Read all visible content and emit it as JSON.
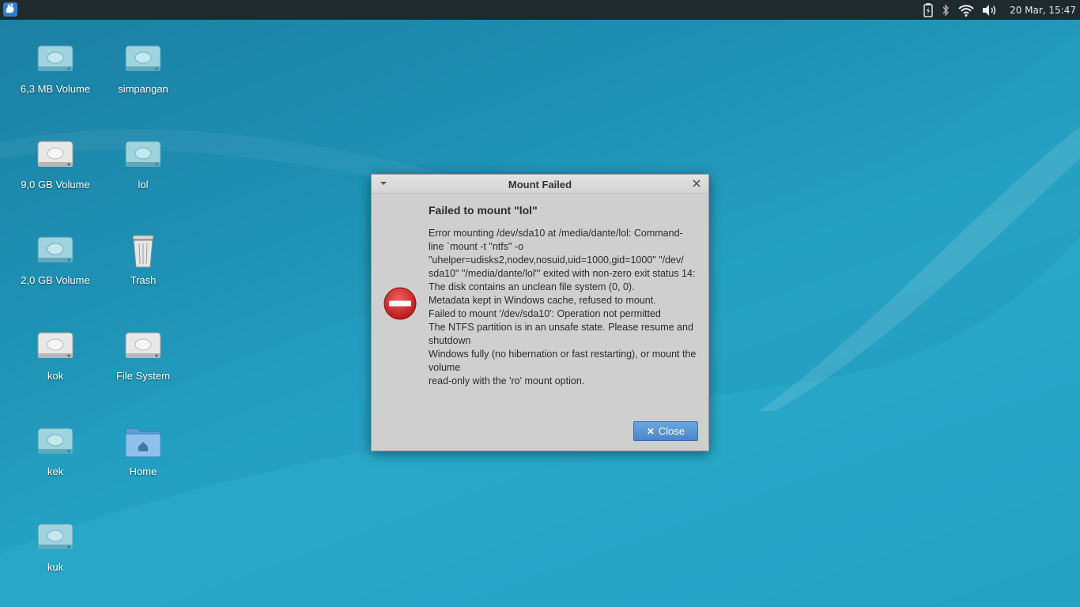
{
  "panel": {
    "clock": "20 Mar, 15:47"
  },
  "desktop": {
    "icons": [
      {
        "label": "6,3 MB Volume",
        "icon": "drive-icon"
      },
      {
        "label": "simpangan",
        "icon": "drive-icon"
      },
      {
        "label": "9,0 GB Volume",
        "icon": "drive-icon"
      },
      {
        "label": "lol",
        "icon": "drive-icon"
      },
      {
        "label": "2,0 GB Volume",
        "icon": "drive-icon"
      },
      {
        "label": "Trash",
        "icon": "trash-icon"
      },
      {
        "label": "kok",
        "icon": "drive-icon"
      },
      {
        "label": "File System",
        "icon": "drive-icon"
      },
      {
        "label": "kek",
        "icon": "drive-icon"
      },
      {
        "label": "Home",
        "icon": "home-folder-icon"
      },
      {
        "label": "kuk",
        "icon": "drive-icon"
      }
    ]
  },
  "dialog": {
    "title": "Mount Failed",
    "heading": "Failed to mount \"lol\"",
    "message_lines": [
      "Error mounting /dev/sda10 at /media/dante/lol: Command-",
      "line `mount -t \"ntfs\" -o",
      "\"uhelper=udisks2,nodev,nosuid,uid=1000,gid=1000\" \"/dev/",
      "sda10\" \"/media/dante/lol\"' exited with non-zero exit status 14:",
      "The disk contains an unclean file system (0, 0).",
      "Metadata kept in Windows cache, refused to mount.",
      "Failed to mount '/dev/sda10': Operation not permitted",
      "The NTFS partition is in an unsafe state. Please resume and",
      "shutdown",
      "Windows fully (no hibernation or fast restarting), or mount the",
      "volume",
      "read-only with the 'ro' mount option."
    ],
    "close_label": "Close"
  },
  "colors": {
    "panel_bg": "#1f2a2f",
    "desktop_accent": "#1e93b6",
    "button_blue": "#4a86c8",
    "error_red": "#d42a2a"
  }
}
